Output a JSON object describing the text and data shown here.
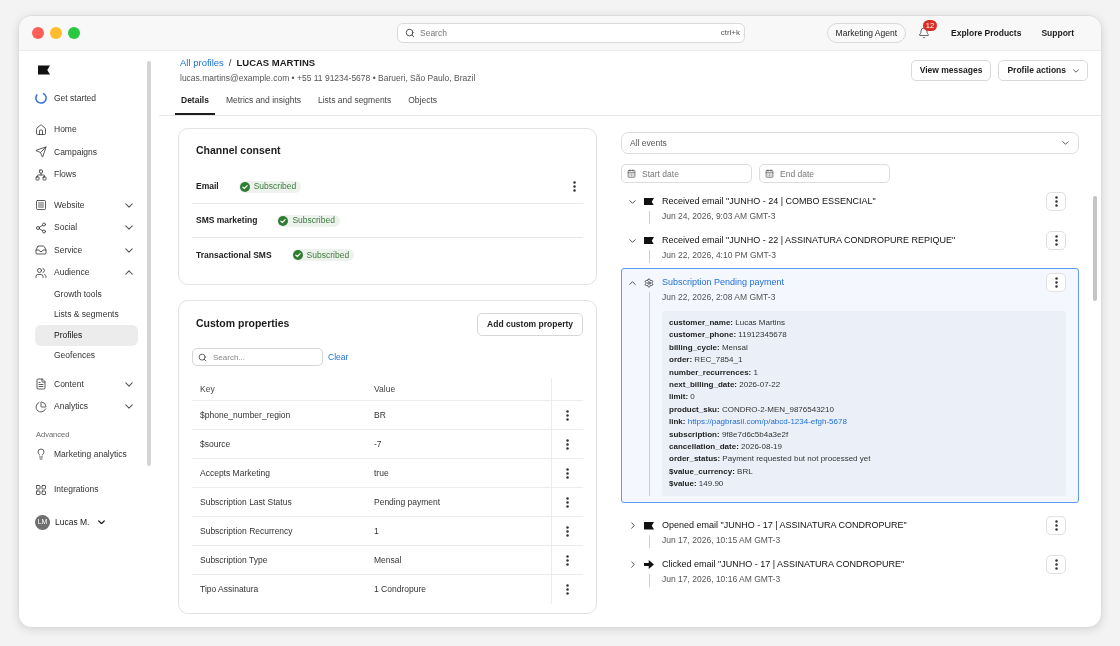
{
  "titlebar": {
    "search": {
      "placeholder": "Search",
      "shortcut": "ctrl+k"
    },
    "agent_button": "Marketing Agent",
    "notification_count": "12",
    "links": [
      "Explore Products",
      "Support"
    ]
  },
  "sidebar": {
    "sections": [
      {
        "items": [
          {
            "label": "Get started",
            "selected": false
          }
        ]
      },
      {
        "items": [
          {
            "label": "Home",
            "selected": false
          },
          {
            "label": "Campaigns",
            "selected": false
          },
          {
            "label": "Flows",
            "selected": false
          }
        ]
      },
      {
        "items": [
          {
            "label": "Website",
            "selected": false,
            "expanded": false
          },
          {
            "label": "Social",
            "selected": false,
            "expanded": false
          },
          {
            "label": "Service",
            "selected": false,
            "expanded": false
          },
          {
            "label": "Audience",
            "selected": false,
            "expanded": true,
            "children": [
              {
                "label": "Growth tools",
                "selected": false
              },
              {
                "label": "Lists & segments",
                "selected": false
              },
              {
                "label": "Profiles",
                "selected": true
              },
              {
                "label": "Geofences",
                "selected": false
              }
            ]
          },
          {
            "label": "Content",
            "selected": false,
            "expanded": false
          },
          {
            "label": "Analytics",
            "selected": false,
            "expanded": false
          }
        ]
      },
      {
        "heading": "Advanced",
        "items": [
          {
            "label": "Marketing analytics",
            "selected": false
          }
        ]
      },
      {
        "items": [
          {
            "label": "Integrations",
            "selected": false
          }
        ]
      }
    ],
    "user": {
      "initials": "LM",
      "name": "Lucas M."
    }
  },
  "profile": {
    "breadcrumb": {
      "parent": "All profiles",
      "separator": "/",
      "current": "LUCAS MARTINS"
    },
    "summary": "lucas.martins@example.com • +55 11 91234-5678 • Barueri, São Paulo, Brazil",
    "actions": [
      {
        "label": "View messages",
        "dropdown": false
      },
      {
        "label": "Profile actions",
        "dropdown": true
      }
    ],
    "tabs": [
      {
        "label": "Details",
        "selected": true
      },
      {
        "label": "Metrics and insights",
        "selected": false
      },
      {
        "label": "Lists and segments",
        "selected": false
      },
      {
        "label": "Objects",
        "selected": false
      }
    ]
  },
  "channel_consent": {
    "title": "Channel consent",
    "channels": [
      {
        "name": "Email",
        "status": "Subscribed",
        "subscribed": true,
        "menu": true
      },
      {
        "name": "SMS marketing",
        "status": "Subscribed",
        "subscribed": true,
        "menu": false
      },
      {
        "name": "Transactional SMS",
        "status": "Subscribed",
        "subscribed": true,
        "menu": false
      }
    ]
  },
  "custom_properties": {
    "title": "Custom properties",
    "add_button": "Add custom property",
    "search": {
      "placeholder": "Search..."
    },
    "clear_link": "Clear",
    "table": {
      "columns": [
        "Key",
        "Value"
      ],
      "rows": [
        {
          "key": "$phone_number_region",
          "value": "BR"
        },
        {
          "key": "$source",
          "value": "-7"
        },
        {
          "key": "Accepts Marketing",
          "value": "true"
        },
        {
          "key": "Subscription Last Status",
          "value": "Pending payment"
        },
        {
          "key": "Subscription Recurrency",
          "value": "1"
        },
        {
          "key": "Subscription Type",
          "value": "Mensal"
        },
        {
          "key": "Tipo Assinatura",
          "value": "1 Condropure"
        }
      ]
    }
  },
  "activity": {
    "filter": {
      "value": "All events"
    },
    "start_date": {
      "placeholder": "Start date"
    },
    "end_date": {
      "placeholder": "End date"
    },
    "events": [
      {
        "kind": "received",
        "title": "Received email \"JUNHO - 24 | COMBO ESSENCIAL\"",
        "time": "Jun 24, 2026, 9:03 AM GMT-3",
        "expanded": false,
        "selected": false
      },
      {
        "kind": "received",
        "title": "Received email \"JUNHO - 22 | ASSINATURA CONDROPURE REPIQUE\"",
        "time": "Jun 22, 2026, 4:10 PM GMT-3",
        "expanded": false,
        "selected": false
      },
      {
        "kind": "custom",
        "title": "Subscription Pending payment",
        "time": "Jun 22, 2026, 2:08 AM GMT-3",
        "expanded": true,
        "selected": true,
        "properties": [
          {
            "kind": "text",
            "key": "customer_name:",
            "value": "Lucas Martins"
          },
          {
            "kind": "text",
            "key": "customer_phone:",
            "value": "11912345678"
          },
          {
            "kind": "text",
            "key": "billing_cycle:",
            "value": "Mensal"
          },
          {
            "kind": "text",
            "key": "order:",
            "value": "REC_7854_1"
          },
          {
            "kind": "text",
            "key": "number_recurrences:",
            "value": "1"
          },
          {
            "kind": "text",
            "key": "next_billing_date:",
            "value": "2026-07-22"
          },
          {
            "kind": "text",
            "key": "limit:",
            "value": "0"
          },
          {
            "kind": "text",
            "key": "product_sku:",
            "value": "CONDRO-2-MEN_9876543210"
          },
          {
            "kind": "link",
            "key": "link:",
            "value": "https://pagbrasil.com/p/abcd-1234-efgh-5678"
          },
          {
            "kind": "text",
            "key": "subscription:",
            "value": "9f8e7d6c5b4a3e2f"
          },
          {
            "kind": "text",
            "key": "cancellation_date:",
            "value": "2026-08-19"
          },
          {
            "kind": "text",
            "key": "order_status:",
            "value": "Payment requested but not processed yet"
          },
          {
            "kind": "text",
            "key": "$value_currency:",
            "value": "BRL"
          },
          {
            "kind": "text",
            "key": "$value:",
            "value": "149.90"
          }
        ]
      },
      {
        "kind": "opened",
        "title": "Opened email \"JUNHO - 17 | ASSINATURA CONDROPURE\"",
        "time": "Jun 17, 2026, 10:15 AM GMT-3",
        "expanded": false,
        "selected": false
      },
      {
        "kind": "clicked",
        "title": "Clicked email \"JUNHO - 17 | ASSINATURA CONDROPURE\"",
        "time": "Jun 17, 2026, 10:16 AM GMT-3",
        "expanded": false,
        "selected": false
      }
    ]
  }
}
